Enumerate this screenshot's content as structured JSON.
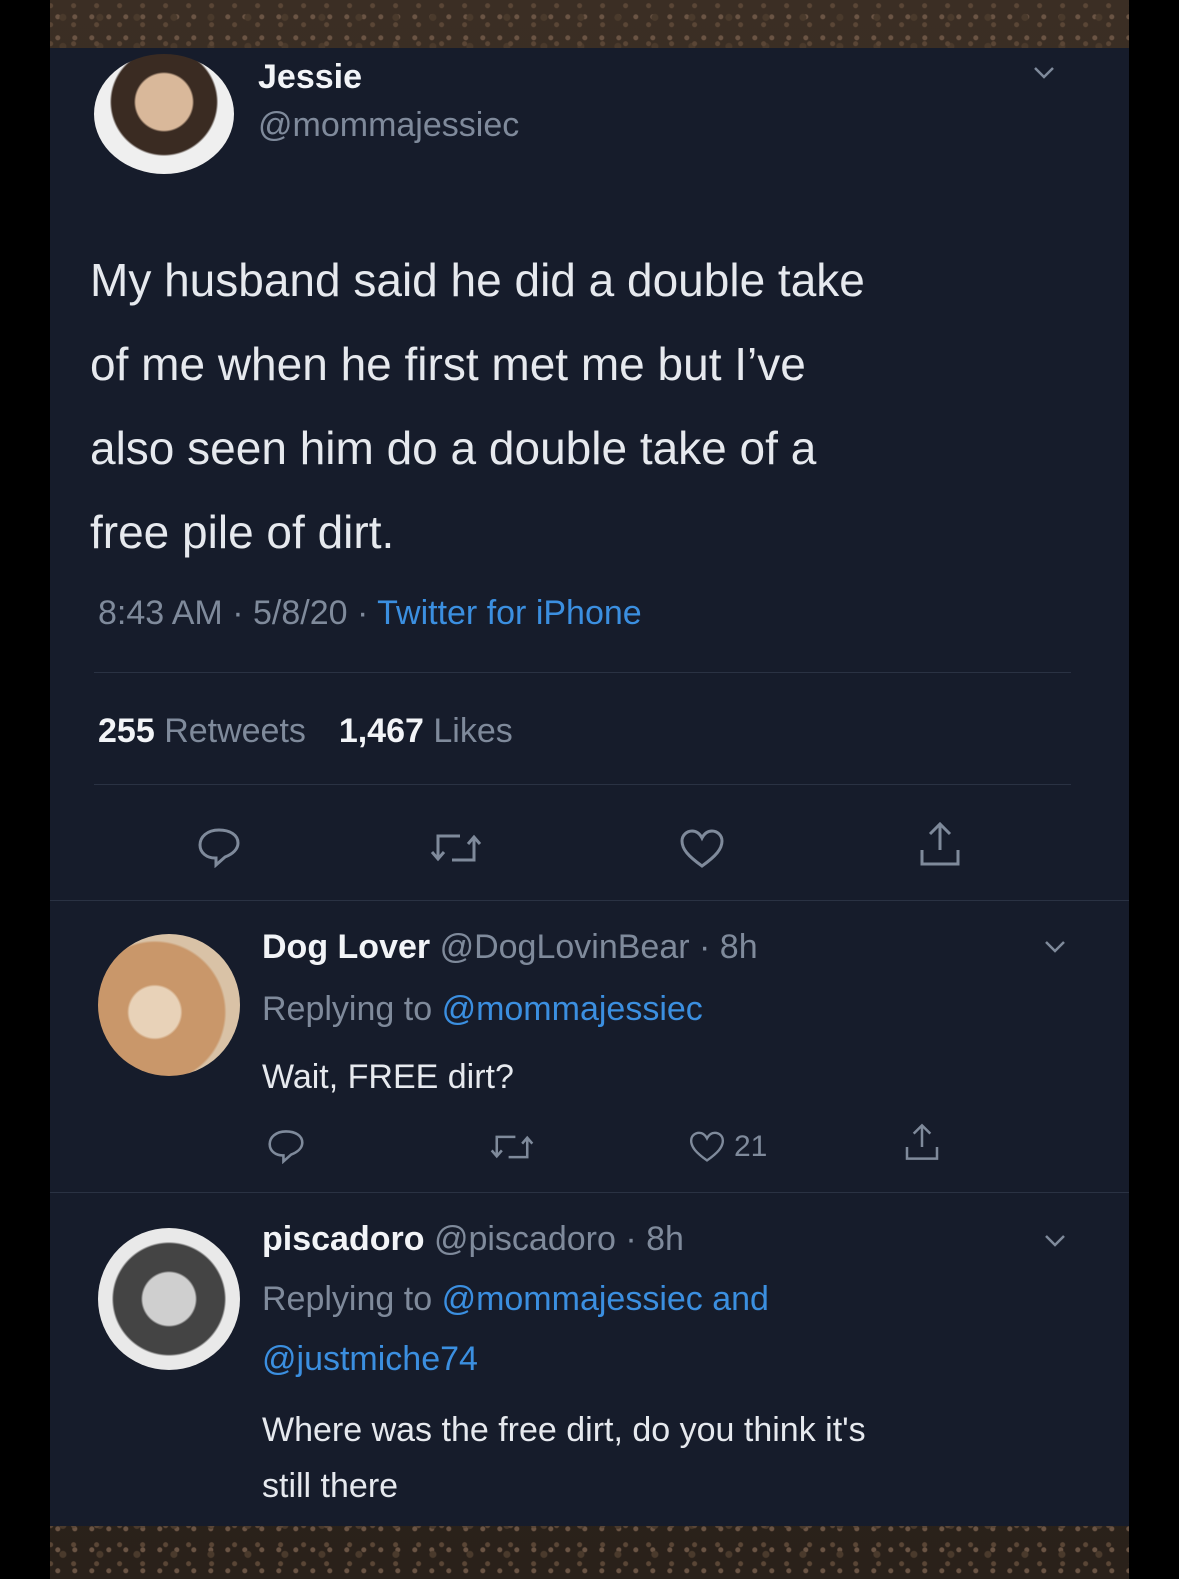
{
  "tweet": {
    "display_name": "Jessie",
    "handle": "@mommajessiec",
    "text_lines": [
      "My husband said he did a double take",
      "of me when he first met me but I’ve",
      "also seen him do a double take of a",
      "free pile of dirt."
    ],
    "time": "8:43 AM",
    "date": "5/8/20",
    "source": "Twitter for iPhone",
    "retweets_count": "255",
    "retweets_label": "Retweets",
    "likes_count": "1,467",
    "likes_label": "Likes"
  },
  "replies": [
    {
      "display_name": "Dog Lover",
      "handle": "@DogLovinBear",
      "age": "8h",
      "replying_prefix": "Replying to",
      "replying_to": "@mommajessiec",
      "text": "Wait, FREE dirt?",
      "likes": "21"
    },
    {
      "display_name": "piscadoro",
      "handle": "@piscadoro",
      "age": "8h",
      "replying_prefix": "Replying to",
      "replying_to": "@mommajessiec and",
      "replying_to_2": "@justmiche74",
      "text_lines": [
        "Where was the free dirt, do you think it's",
        "still there"
      ]
    }
  ],
  "icons": [
    "chevron-down-icon",
    "reply-icon",
    "retweet-icon",
    "like-icon",
    "share-icon"
  ],
  "colors": {
    "background": "#161c2b",
    "link": "#3b8fe0",
    "muted": "#7f8a9b"
  }
}
